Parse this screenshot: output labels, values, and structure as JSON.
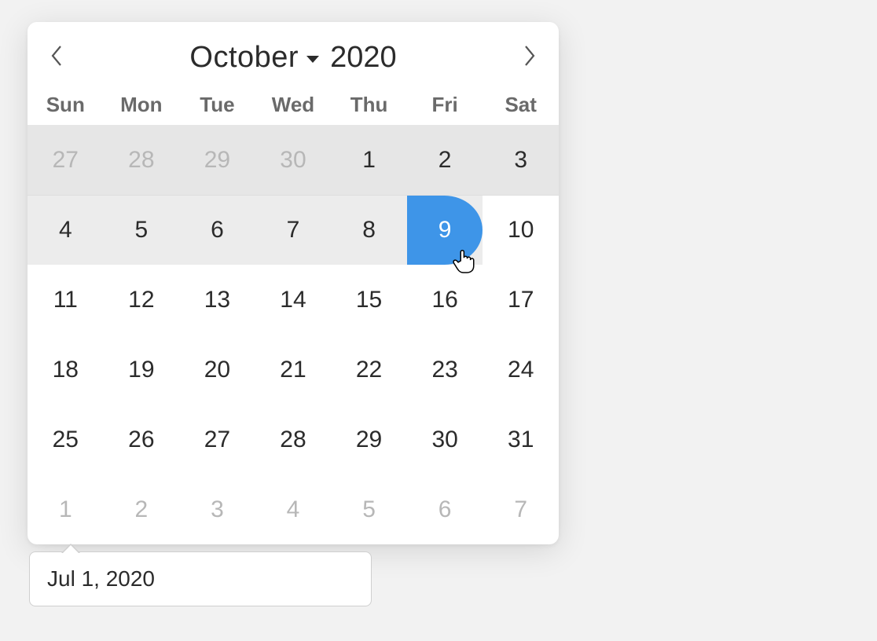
{
  "calendar": {
    "month_label": "October",
    "year_label": "2020",
    "dow": [
      "Sun",
      "Mon",
      "Tue",
      "Wed",
      "Thu",
      "Fri",
      "Sat"
    ],
    "rows": [
      [
        {
          "n": "27",
          "outside": true
        },
        {
          "n": "28",
          "outside": true
        },
        {
          "n": "29",
          "outside": true
        },
        {
          "n": "30",
          "outside": true
        },
        {
          "n": "1",
          "outside": false
        },
        {
          "n": "2",
          "outside": false
        },
        {
          "n": "3",
          "outside": false
        }
      ],
      [
        {
          "n": "4",
          "outside": false
        },
        {
          "n": "5",
          "outside": false
        },
        {
          "n": "6",
          "outside": false
        },
        {
          "n": "7",
          "outside": false
        },
        {
          "n": "8",
          "outside": false
        },
        {
          "n": "9",
          "outside": false,
          "selected": true
        },
        {
          "n": "10",
          "outside": false
        }
      ],
      [
        {
          "n": "11",
          "outside": false
        },
        {
          "n": "12",
          "outside": false
        },
        {
          "n": "13",
          "outside": false
        },
        {
          "n": "14",
          "outside": false
        },
        {
          "n": "15",
          "outside": false
        },
        {
          "n": "16",
          "outside": false
        },
        {
          "n": "17",
          "outside": false
        }
      ],
      [
        {
          "n": "18",
          "outside": false
        },
        {
          "n": "19",
          "outside": false
        },
        {
          "n": "20",
          "outside": false
        },
        {
          "n": "21",
          "outside": false
        },
        {
          "n": "22",
          "outside": false
        },
        {
          "n": "23",
          "outside": false
        },
        {
          "n": "24",
          "outside": false
        }
      ],
      [
        {
          "n": "25",
          "outside": false
        },
        {
          "n": "26",
          "outside": false
        },
        {
          "n": "27",
          "outside": false
        },
        {
          "n": "28",
          "outside": false
        },
        {
          "n": "29",
          "outside": false
        },
        {
          "n": "30",
          "outside": false
        },
        {
          "n": "31",
          "outside": false
        }
      ],
      [
        {
          "n": "1",
          "outside": true
        },
        {
          "n": "2",
          "outside": true
        },
        {
          "n": "3",
          "outside": true
        },
        {
          "n": "4",
          "outside": true
        },
        {
          "n": "5",
          "outside": true
        },
        {
          "n": "6",
          "outside": true
        },
        {
          "n": "7",
          "outside": true
        }
      ]
    ]
  },
  "input": {
    "value": "Jul 1, 2020"
  },
  "colors": {
    "accent": "#3e95e8"
  }
}
